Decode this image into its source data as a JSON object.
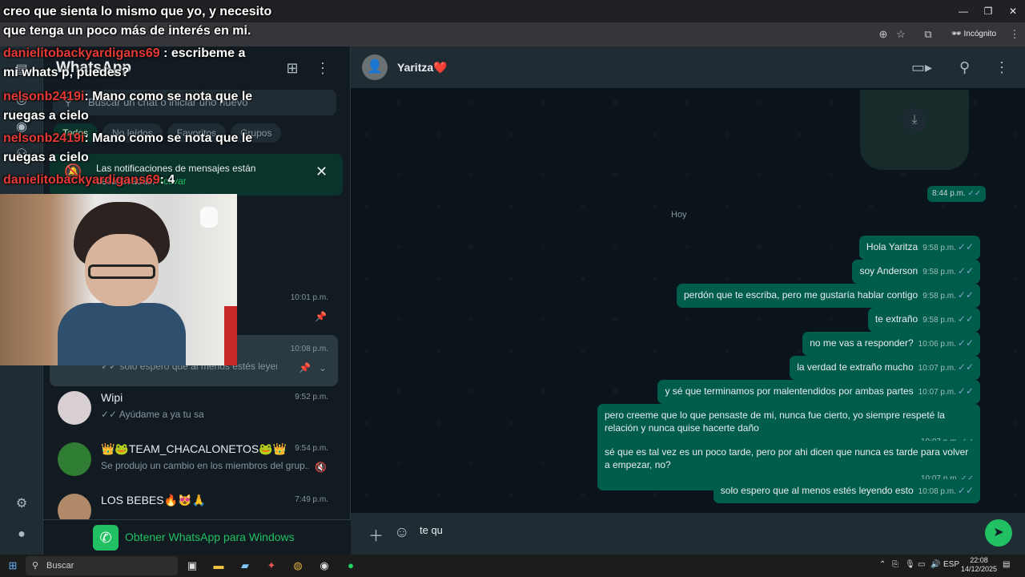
{
  "browser": {
    "window_controls": [
      "—",
      "❐",
      "✕"
    ],
    "incognito_label": "Incógnito"
  },
  "overlay": {
    "lines": [
      {
        "user": "",
        "text": "creo que sienta lo mismo que yo, y necesito"
      },
      {
        "user": "",
        "text": "que tenga un poco más de interés en mi."
      },
      {
        "user": "danielitobackyardigans69",
        "text": ": escribeme a"
      },
      {
        "user": "",
        "text": "mi whats p, puedes?"
      },
      {
        "user": "nelsonb2419i",
        "text": ": Mano como se nota que le"
      },
      {
        "user": "",
        "text": "ruegas a cielo"
      },
      {
        "user": "nelsonb2419i",
        "text": ": Mano como se nota que le"
      },
      {
        "user": "",
        "text": "ruegas a cielo"
      },
      {
        "user": "danielitobackyardigans69",
        "text": ": 4"
      }
    ]
  },
  "sidebar": {
    "title": "WhatsApp",
    "search_placeholder": "Buscar un chat o iniciar uno nuevo",
    "filters": [
      "Todos",
      "No leídos",
      "Favoritos",
      "Grupos"
    ],
    "notification": {
      "text": "Las notificaciones de mensajes están desactivadas.",
      "link": "Activar"
    },
    "chats": [
      {
        "name": "",
        "time": "10:01 p.m.",
        "snippet": ""
      },
      {
        "name": "",
        "time": "10:08 p.m.",
        "snippet": "✓✓ solo espero que al menos estés leyendo ..."
      },
      {
        "name": "Wipi",
        "time": "9:52 p.m.",
        "snippet": "✓✓ Ayúdame a ya tu sa"
      },
      {
        "name": "👑🐸TEAM_CHACALONETOS🐸👑",
        "time": "9:54 p.m.",
        "snippet": "Se produjo un cambio en los miembros del grup..."
      },
      {
        "name": "LOS BEBES🔥😻🙏",
        "time": "7:49 p.m.",
        "snippet": ""
      }
    ],
    "get_app_label": "Obtener WhatsApp para Windows"
  },
  "chat": {
    "contact_name": "Yaritza❤️",
    "media_time": "8:44 p.m.",
    "day_separator": "Hoy",
    "messages": [
      {
        "text": "Hola Yaritza",
        "time": "9:58 p.m."
      },
      {
        "text": "soy Anderson",
        "time": "9:58 p.m."
      },
      {
        "text": "perdón que te escriba, pero me gustaría hablar contigo",
        "time": "9:58 p.m."
      },
      {
        "text": "te extraño",
        "time": "9:58 p.m."
      },
      {
        "text": "no me vas a responder?",
        "time": "10:06 p.m."
      },
      {
        "text": "la verdad te extraño mucho",
        "time": "10:07 p.m."
      },
      {
        "text": "y sé que terminamos por malentendidos por ambas partes",
        "time": "10:07 p.m."
      },
      {
        "text": "pero creeme que lo que pensaste de mi, nunca fue cierto, yo siempre respeté la relación y nunca quise hacerte daño",
        "time": "10:07 p.m."
      },
      {
        "text": "sé que es tal vez es un poco tarde, pero por ahi dicen que nunca es tarde para volver a empezar, no?",
        "time": "10:07 p.m."
      },
      {
        "text": "solo espero que al menos estés leyendo esto",
        "time": "10:08 p.m."
      }
    ],
    "composer_value": "te qu"
  },
  "taskbar": {
    "search_label": "Buscar",
    "lang": "ESP",
    "time": "22:08",
    "date": "14/12/2025"
  },
  "colors": {
    "accent": "#21c063",
    "bubble_out": "#005c4b",
    "panel": "#202c33",
    "background": "#111b21"
  }
}
